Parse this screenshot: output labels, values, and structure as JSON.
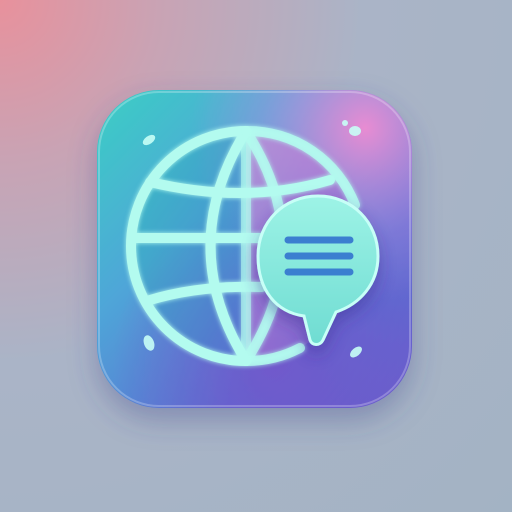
{
  "icon": {
    "name": "globe-chat-app-icon",
    "depicts": [
      "globe-icon",
      "chat-bubble-icon",
      "text-lines-icon"
    ]
  },
  "colors": {
    "background_top_left": "#e8919c",
    "background": "#a8b5c6",
    "tile_teal": "#3bcfc4",
    "tile_blue": "#4b74d6",
    "tile_pink": "#e88bd0",
    "tile_purple": "#7a4fc8",
    "glyph_mint": "#b3fbef",
    "bubble": "#86ece0"
  }
}
